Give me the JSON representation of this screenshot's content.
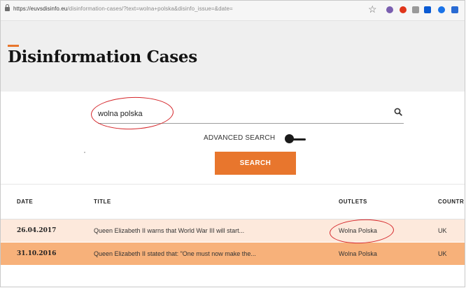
{
  "browser": {
    "url_domain": "https://euvsdisinfo.eu",
    "url_path": "/disinformation-cases/?text=wolna+polska&disinfo_issue=&date="
  },
  "page": {
    "title": "Disinformation Cases"
  },
  "search": {
    "query": "wolna polska",
    "advanced_label": "ADVANCED SEARCH",
    "button_label": "SEARCH"
  },
  "table": {
    "headers": [
      "DATE",
      "TITLE",
      "OUTLETS",
      "COUNTR"
    ],
    "rows": [
      {
        "date": "26.04.2017",
        "title": "Queen Elizabeth II warns that World War III will start...",
        "outlet": "Wolna Polska",
        "country": "UK"
      },
      {
        "date": "31.10.2016",
        "title": "Queen Elizabeth II stated that: \"One must now make the...",
        "outlet": "Wolna Polska",
        "country": "UK"
      }
    ]
  },
  "colors": {
    "accent": "#e8762d",
    "row_light": "#fde9dc",
    "row_dark": "#f7b17a",
    "annotation": "#d5262a"
  },
  "icons": [
    "lock-icon",
    "star-icon",
    "search-icon",
    "extension-icons"
  ]
}
